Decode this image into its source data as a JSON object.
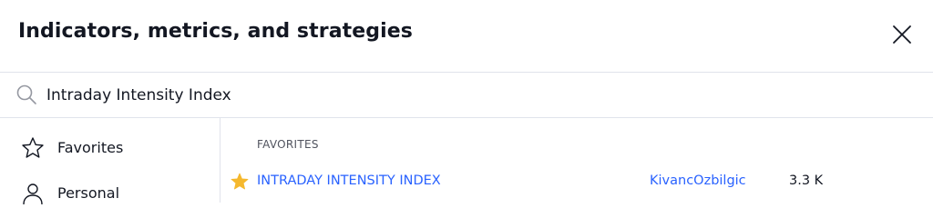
{
  "dialog": {
    "title": "Indicators, metrics, and strategies",
    "close_icon": "close-icon"
  },
  "search": {
    "value": "Intraday Intensity Index",
    "icon": "search-icon"
  },
  "sidebar": {
    "items": [
      {
        "label": "Favorites",
        "icon": "star-outline-icon"
      },
      {
        "label": "Personal",
        "icon": "user-icon"
      }
    ]
  },
  "main": {
    "section_title": "FAVORITES",
    "results": [
      {
        "name": "INTRADAY INTENSITY INDEX",
        "author": "KivancOzbilgic",
        "count": "3.3 K",
        "favorite": true
      }
    ]
  },
  "colors": {
    "text": "#131722",
    "link": "#2962ff",
    "star": "#f5b82e",
    "divider": "#e0e3eb",
    "muted": "#50535e"
  }
}
